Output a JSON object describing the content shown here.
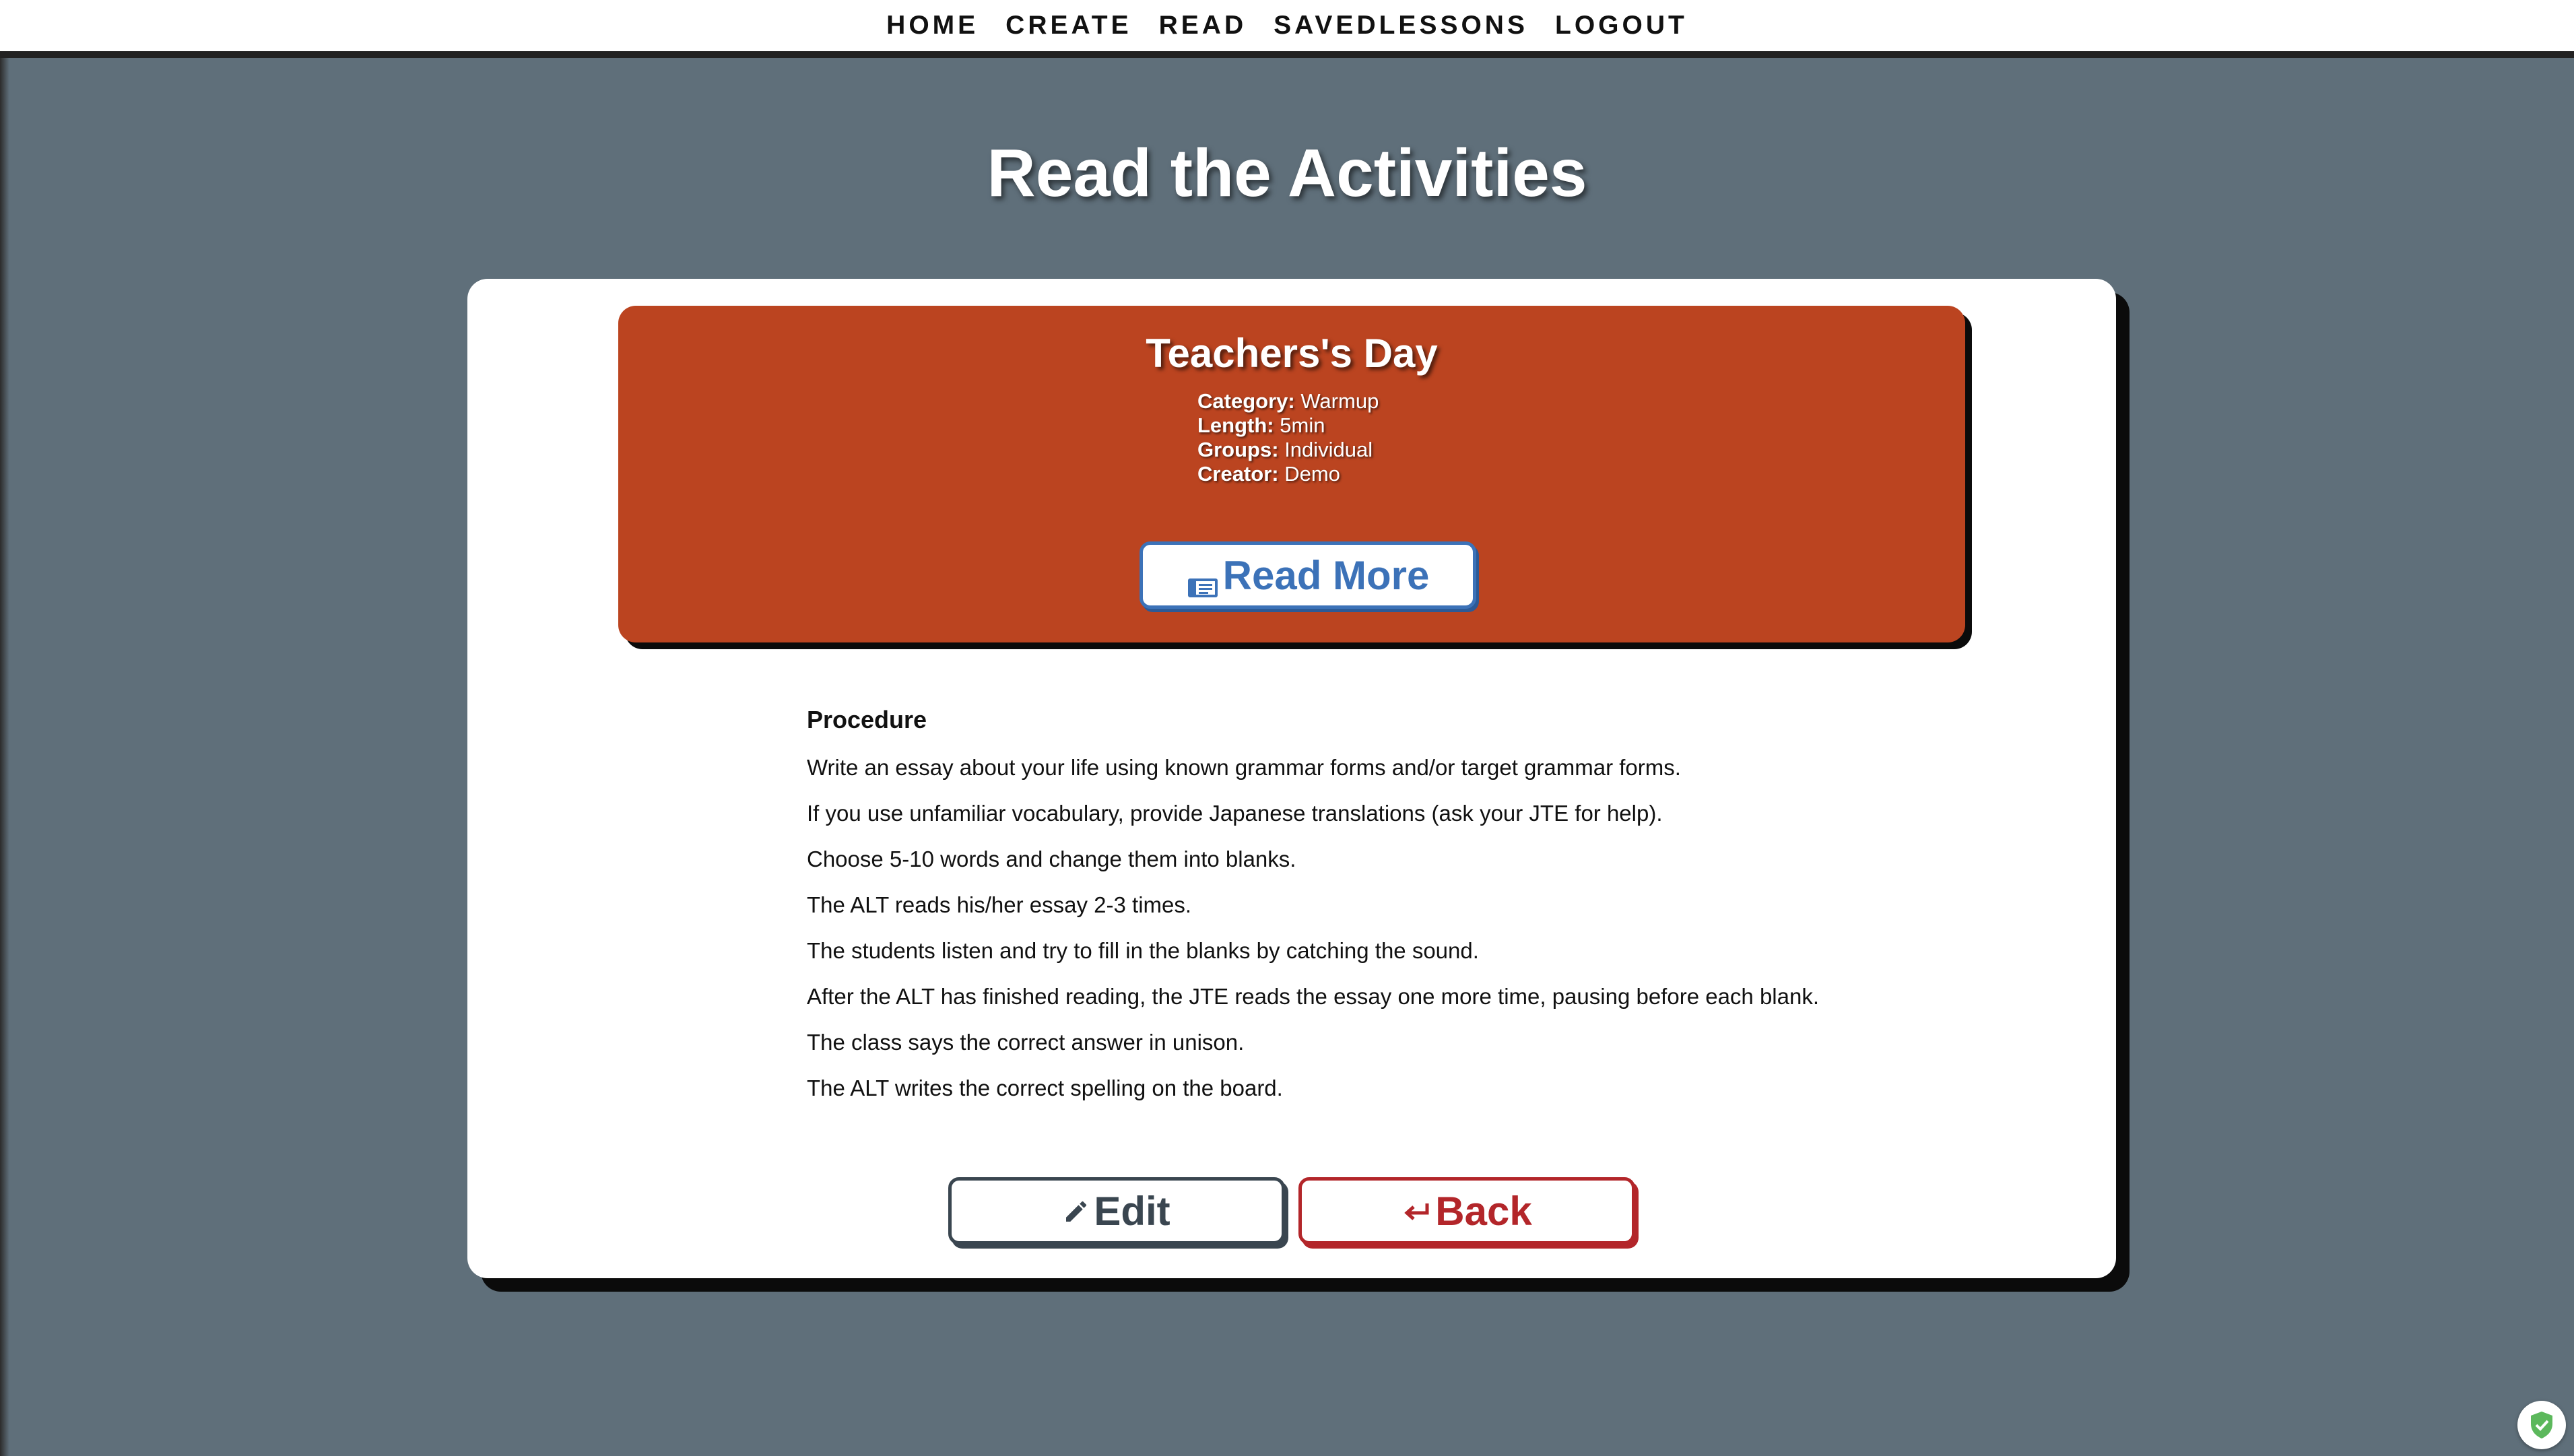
{
  "nav": {
    "items": [
      {
        "label": "HOME"
      },
      {
        "label": "CREATE"
      },
      {
        "label": "READ"
      },
      {
        "label": "SAVEDLESSONS"
      },
      {
        "label": "LOGOUT"
      }
    ]
  },
  "page": {
    "title": "Read the Activities"
  },
  "activity": {
    "title": "Teachers's Day",
    "meta": [
      {
        "label": "Category:",
        "value": "Warmup"
      },
      {
        "label": "Length:",
        "value": "5min"
      },
      {
        "label": "Groups:",
        "value": "Individual"
      },
      {
        "label": "Creator:",
        "value": "Demo"
      }
    ],
    "read_more_label": "Read More",
    "read_more_icon": "book-icon"
  },
  "procedure": {
    "heading": "Procedure",
    "steps": [
      "Write an essay about your life using known grammar forms and/or target grammar forms.",
      "If you use unfamiliar vocabulary, provide Japanese translations (ask your JTE for help).",
      "Choose 5-10 words and change them into blanks.",
      "The ALT reads his/her essay 2-3 times.",
      "The students listen and try to fill in the blanks by catching the sound.",
      "After the ALT has finished reading, the JTE reads the essay one more time, pausing before each blank.",
      "The class says the correct answer in unison.",
      "The ALT writes the correct spelling on the board."
    ]
  },
  "actions": {
    "edit_label": "Edit",
    "edit_icon": "pencil-icon",
    "back_label": "Back",
    "back_icon": "return-arrow-icon"
  },
  "colors": {
    "background": "#5f6f7a",
    "activity_card": "#bb4420",
    "read_more": "#3c72b8",
    "edit": "#3a4650",
    "back": "#b3262a"
  }
}
